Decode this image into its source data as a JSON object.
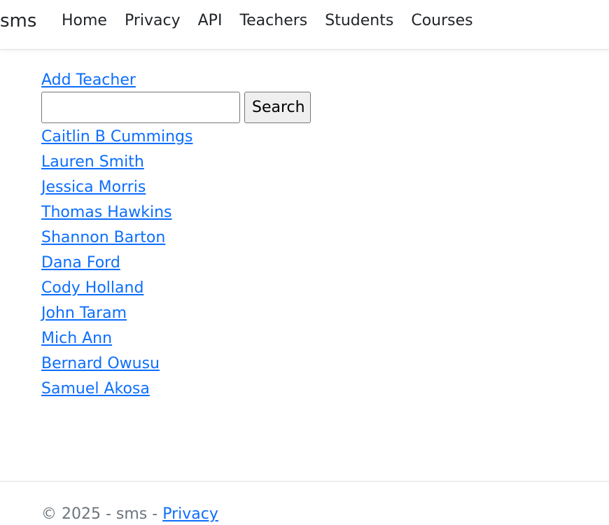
{
  "navbar": {
    "brand": "sms",
    "links": [
      "Home",
      "Privacy",
      "API",
      "Teachers",
      "Students",
      "Courses"
    ]
  },
  "main": {
    "add_link": "Add Teacher",
    "search": {
      "value": "",
      "button_label": "Search"
    },
    "teachers": [
      "Caitlin B Cummings",
      "Lauren Smith",
      "Jessica Morris",
      "Thomas Hawkins",
      "Shannon Barton",
      "Dana Ford",
      "Cody Holland",
      "John Taram",
      "Mich Ann",
      "Bernard Owusu",
      "Samuel Akosa"
    ]
  },
  "footer": {
    "text": "© 2025 - sms - ",
    "privacy_link": "Privacy"
  },
  "colors": {
    "link": "#0d6efd",
    "text": "#212529",
    "muted": "#6c757d",
    "border": "#dee2e6"
  }
}
